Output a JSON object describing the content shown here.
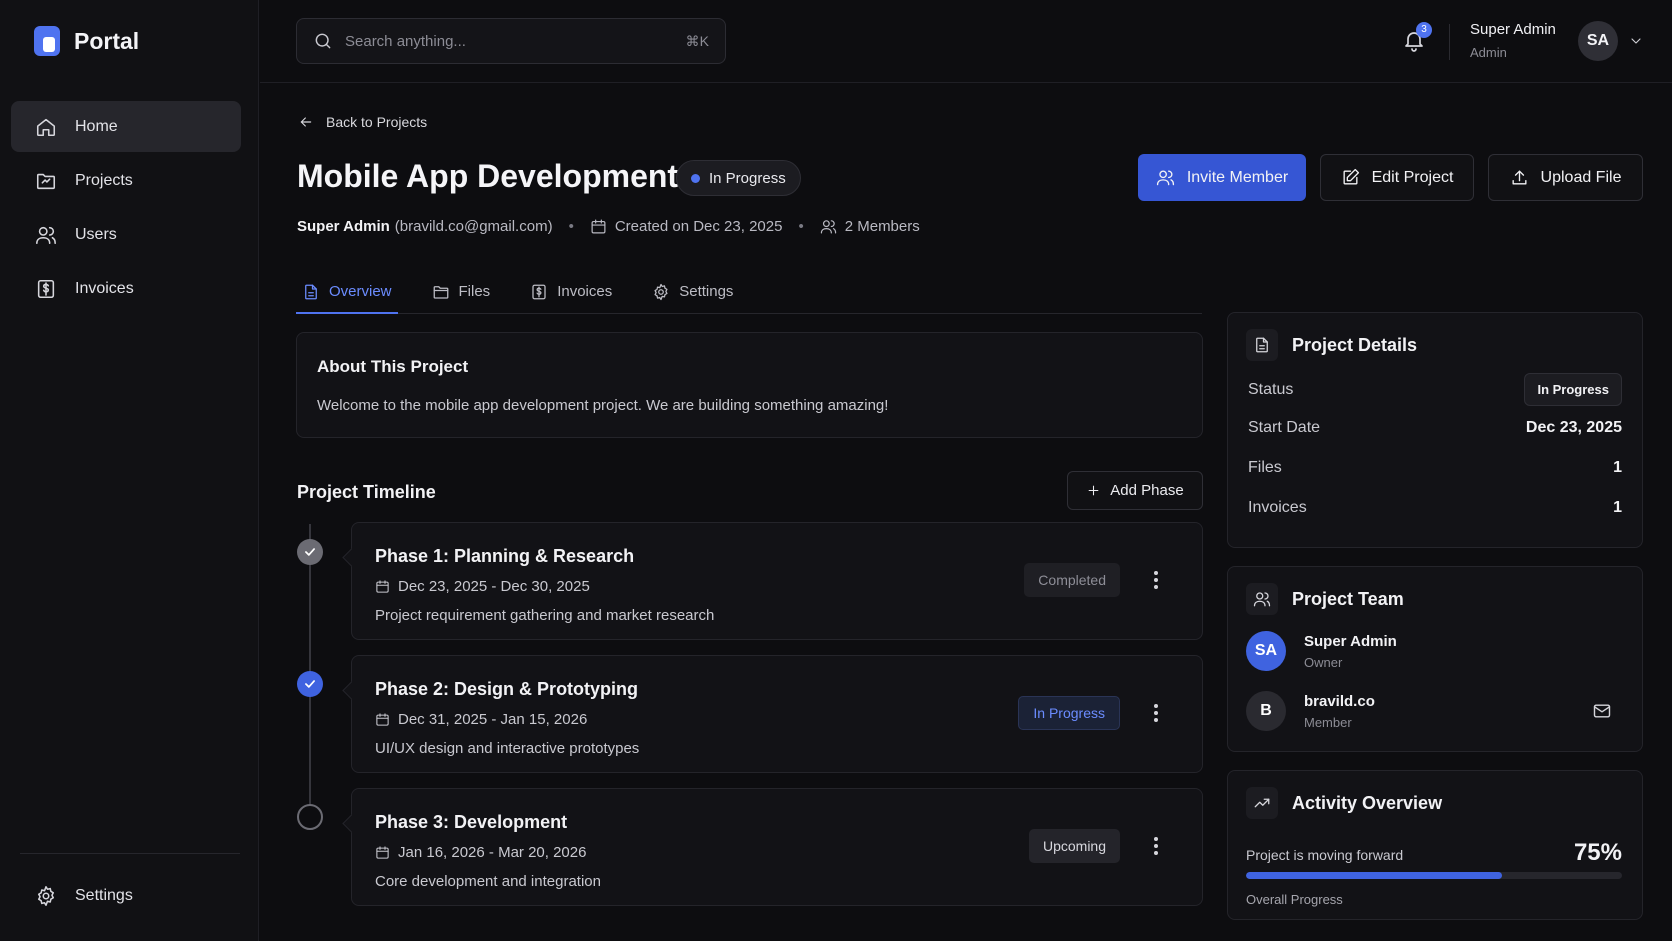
{
  "brand": {
    "name": "Portal"
  },
  "sidebar": {
    "items": [
      {
        "label": "Home",
        "icon": "home-icon"
      },
      {
        "label": "Projects",
        "icon": "folder-icon"
      },
      {
        "label": "Users",
        "icon": "users-icon"
      },
      {
        "label": "Invoices",
        "icon": "invoice-icon"
      }
    ],
    "settings_label": "Settings"
  },
  "topbar": {
    "search_placeholder": "Search anything...",
    "search_shortcut": "⌘K",
    "notification_count": "3",
    "user_name": "Super Admin",
    "user_role": "Admin",
    "avatar_initials": "SA"
  },
  "header": {
    "back_label": "Back to Projects",
    "title": "Mobile App Development",
    "status": "In Progress",
    "owner_name": "Super Admin",
    "owner_email": "(bravild.co@gmail.com)",
    "created": "Created on Dec 23, 2025",
    "members": "2 Members",
    "invite_label": "Invite Member",
    "edit_label": "Edit Project",
    "upload_label": "Upload File"
  },
  "tabs": [
    {
      "label": "Overview"
    },
    {
      "label": "Files"
    },
    {
      "label": "Invoices"
    },
    {
      "label": "Settings"
    }
  ],
  "about": {
    "title": "About This Project",
    "text": "Welcome to the mobile app development project. We are building something amazing!"
  },
  "timeline": {
    "title": "Project Timeline",
    "add_label": "Add Phase",
    "phases": [
      {
        "title": "Phase 1: Planning & Research",
        "dates": "Dec 23, 2025 - Dec 30, 2025",
        "description": "Project requirement gathering and market research",
        "status": "Completed"
      },
      {
        "title": "Phase 2: Design & Prototyping",
        "dates": "Dec 31, 2025 - Jan 15, 2026",
        "description": "UI/UX design and interactive prototypes",
        "status": "In Progress"
      },
      {
        "title": "Phase 3: Development",
        "dates": "Jan 16, 2026 - Mar 20, 2026",
        "description": "Core development and integration",
        "status": "Upcoming"
      }
    ]
  },
  "details": {
    "title": "Project Details",
    "rows": [
      {
        "key": "Status",
        "value": "In Progress"
      },
      {
        "key": "Start Date",
        "value": "Dec 23, 2025"
      },
      {
        "key": "Files",
        "value": "1"
      },
      {
        "key": "Invoices",
        "value": "1"
      }
    ]
  },
  "team": {
    "title": "Project Team",
    "members": [
      {
        "initials": "SA",
        "name": "Super Admin",
        "role": "Owner"
      },
      {
        "initials": "B",
        "name": "bravild.co",
        "role": "Member"
      }
    ]
  },
  "activity": {
    "title": "Activity Overview",
    "label": "Project is moving forward",
    "percent_text": "75%",
    "progress": 0.68,
    "sub": "Overall Progress"
  },
  "colors": {
    "accent": "#4f73f0",
    "primary_button": "#3656d4",
    "background": "#0d0d10"
  }
}
